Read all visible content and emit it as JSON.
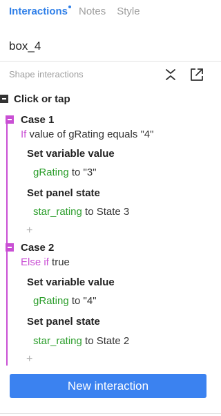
{
  "tabs": [
    {
      "label": "Interactions",
      "active": true,
      "has_dot": true
    },
    {
      "label": "Notes",
      "active": false
    },
    {
      "label": "Style",
      "active": false
    }
  ],
  "shape_name": "box_4",
  "section_header": "Shape interactions",
  "icons": {
    "collapse": "collapse-all-icon",
    "popout": "popout-icon"
  },
  "event": {
    "label": "Click or tap"
  },
  "cases": [
    {
      "label": "Case 1",
      "condition": {
        "keyword": "If",
        "text": "value of gRating equals \"4\""
      },
      "actions": [
        {
          "title": "Set variable value",
          "target": "gRating",
          "detail": "to \"3\""
        },
        {
          "title": "Set panel state",
          "target": "star_rating",
          "detail": "to State 3"
        }
      ],
      "add_label": "+"
    },
    {
      "label": "Case 2",
      "condition": {
        "keyword": "Else if",
        "text": "true"
      },
      "actions": [
        {
          "title": "Set variable value",
          "target": "gRating",
          "detail": "to \"4\""
        },
        {
          "title": "Set panel state",
          "target": "star_rating",
          "detail": "to State 2"
        }
      ],
      "add_label": "+"
    }
  ],
  "new_interaction_label": "New interaction",
  "colors": {
    "accent": "#2f7fe8",
    "button": "#3b82f0",
    "case_marker": "#c94fd4",
    "keyword": "#c94fd4",
    "target": "#2a9d2a"
  }
}
